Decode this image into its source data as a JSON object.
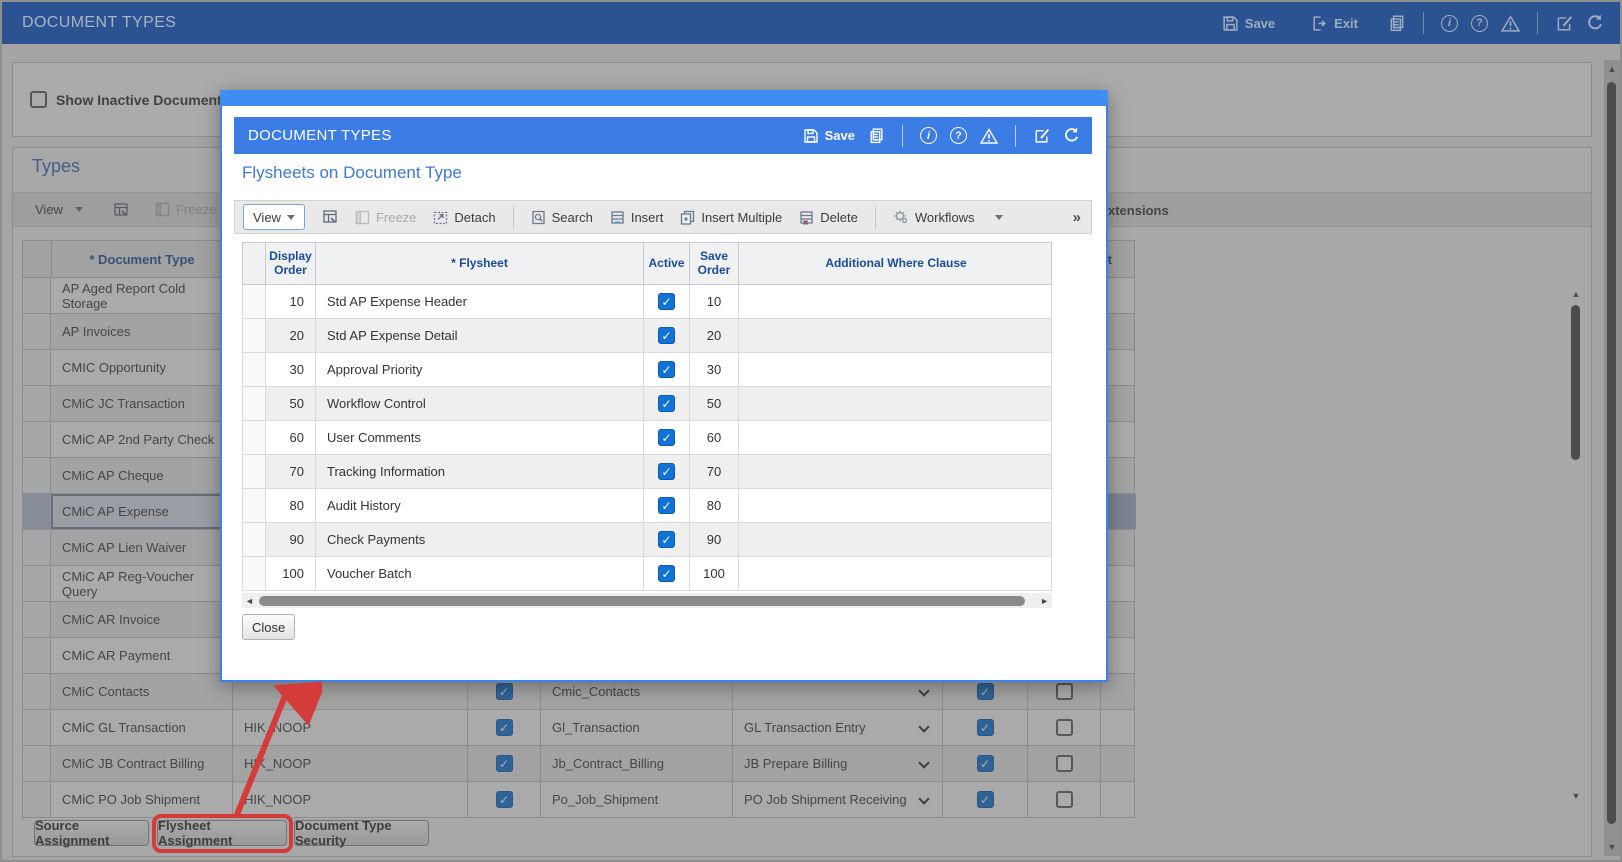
{
  "app_header": {
    "title": "DOCUMENT TYPES",
    "save": "Save",
    "exit": "Exit"
  },
  "page": {
    "show_inactive_label": "Show Inactive Document Types",
    "types_heading": "Types",
    "toolbar": {
      "view": "View",
      "freeze": "Freeze"
    },
    "extensions_header_fragment": "xtensions",
    "edit_header_fragment": "it",
    "table": {
      "document_type_header": "* Document Type",
      "rows": [
        {
          "document_type": "AP Aged Report Cold Storage"
        },
        {
          "document_type": "AP Invoices"
        },
        {
          "document_type": "CMIC Opportunity"
        },
        {
          "document_type": "CMiC  JC Transaction"
        },
        {
          "document_type": "CMiC AP 2nd Party Check"
        },
        {
          "document_type": "CMiC AP Cheque"
        },
        {
          "document_type": "CMiC AP Expense",
          "selected": true
        },
        {
          "document_type": "CMiC AP Lien Waiver"
        },
        {
          "document_type": "CMiC AP Reg-Voucher Query"
        },
        {
          "document_type": "CMiC AR Invoice"
        },
        {
          "document_type": "CMiC AR Payment"
        },
        {
          "document_type": "CMiC Contacts",
          "source": "",
          "active": true,
          "flysheet_set": "Cmic_Contacts",
          "workflow": "",
          "workflow_active": true,
          "extra_checked": false
        },
        {
          "document_type": "CMiC GL Transaction",
          "source": "HIK_NOOP",
          "active": true,
          "flysheet_set": "Gl_Transaction",
          "workflow": "GL Transaction Entry",
          "workflow_active": true,
          "extra_checked": false
        },
        {
          "document_type": "CMiC JB Contract Billing",
          "source": "HIK_NOOP",
          "active": true,
          "flysheet_set": "Jb_Contract_Billing",
          "workflow": "JB Prepare Billing",
          "workflow_active": true,
          "extra_checked": false
        },
        {
          "document_type": "CMiC PO Job Shipment",
          "source": "HIK_NOOP",
          "active": true,
          "flysheet_set": "Po_Job_Shipment",
          "workflow": "PO Job Shipment Receiving",
          "workflow_active": true,
          "extra_checked": false
        }
      ]
    },
    "footer_buttons": {
      "source_assignment": "Source Assignment",
      "flysheet_assignment": "Flysheet Assignment",
      "document_type_security": "Document Type Security"
    }
  },
  "modal": {
    "header": {
      "title": "DOCUMENT TYPES",
      "save": "Save"
    },
    "subtitle": "Flysheets on Document Type",
    "toolbar": {
      "view": "View",
      "freeze": "Freeze",
      "detach": "Detach",
      "search": "Search",
      "insert": "Insert",
      "insert_multiple": "Insert Multiple",
      "delete": "Delete",
      "workflows": "Workflows",
      "overflow": "»"
    },
    "table": {
      "headers": {
        "display_order": "Display Order",
        "flysheet": "* Flysheet",
        "active": "Active",
        "save_order": "Save Order",
        "where": "Additional Where Clause"
      },
      "rows": [
        {
          "display_order": "10",
          "flysheet": "Std AP Expense Header",
          "active": true,
          "save_order": "10",
          "where": ""
        },
        {
          "display_order": "20",
          "flysheet": "Std AP Expense Detail",
          "active": true,
          "save_order": "20",
          "where": ""
        },
        {
          "display_order": "30",
          "flysheet": "Approval Priority",
          "active": true,
          "save_order": "30",
          "where": ""
        },
        {
          "display_order": "50",
          "flysheet": "Workflow Control",
          "active": true,
          "save_order": "50",
          "where": ""
        },
        {
          "display_order": "60",
          "flysheet": "User Comments",
          "active": true,
          "save_order": "60",
          "where": ""
        },
        {
          "display_order": "70",
          "flysheet": "Tracking Information",
          "active": true,
          "save_order": "70",
          "where": ""
        },
        {
          "display_order": "80",
          "flysheet": "Audit History",
          "active": true,
          "save_order": "80",
          "where": ""
        },
        {
          "display_order": "90",
          "flysheet": "Check Payments",
          "active": true,
          "save_order": "90",
          "where": ""
        },
        {
          "display_order": "100",
          "flysheet": "Voucher Batch",
          "active": true,
          "save_order": "100",
          "where": ""
        }
      ]
    },
    "close": "Close"
  },
  "colors": {
    "app_header_bg": "#2b5391",
    "modal_strip": "#3f8cf3",
    "modal_header_bg": "#3c7ce5",
    "checkbox_blue": "#1173d6",
    "header_text_blue": "#1d4f9e",
    "annotation_red": "#d43c3c"
  }
}
